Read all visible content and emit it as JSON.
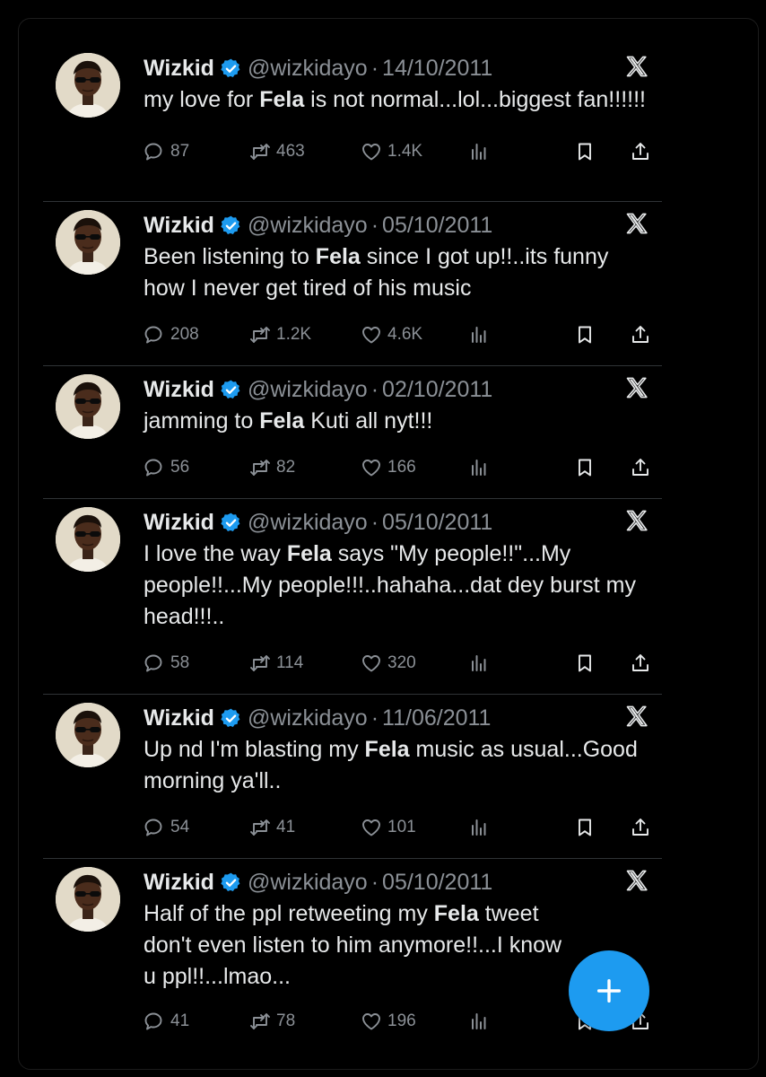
{
  "tweets": [
    {
      "name": "Wizkid",
      "handle": "@wizkidayo",
      "separator": "·",
      "date": "14/10/2011",
      "text_parts": [
        "my love for ",
        "Fela",
        " is not normal...lol...biggest fan!!!!!!"
      ],
      "replies": "87",
      "retweets": "463",
      "likes": "1.4K"
    },
    {
      "name": "Wizkid",
      "handle": "@wizkidayo",
      "separator": "·",
      "date": "05/10/2011",
      "text_parts": [
        "Been listening to ",
        "Fela",
        " since I got up!!..its funny how I never get tired of his music"
      ],
      "replies": "208",
      "retweets": "1.2K",
      "likes": "4.6K"
    },
    {
      "name": "Wizkid",
      "handle": "@wizkidayo",
      "separator": "·",
      "date": "02/10/2011",
      "text_parts": [
        "jamming to ",
        "Fela",
        " Kuti all nyt!!!"
      ],
      "replies": "56",
      "retweets": "82",
      "likes": "166"
    },
    {
      "name": "Wizkid",
      "handle": "@wizkidayo",
      "separator": "·",
      "date": "05/10/2011",
      "text_parts": [
        "I love the way ",
        "Fela",
        " says \"My people!!\"...My people!!...My people!!!..hahaha...dat dey burst my head!!!.."
      ],
      "replies": "58",
      "retweets": "114",
      "likes": "320"
    },
    {
      "name": "Wizkid",
      "handle": "@wizkidayo",
      "separator": "·",
      "date": "11/06/2011",
      "text_parts": [
        "Up nd I'm blasting my ",
        "Fela",
        " music as usual...Good morning ya'll.."
      ],
      "replies": "54",
      "retweets": "41",
      "likes": "101"
    },
    {
      "name": "Wizkid",
      "handle": "@wizkidayo",
      "separator": "·",
      "date": "05/10/2011",
      "text_parts": [
        "Half of the ppl retweeting my ",
        "Fela",
        " tweet don't even listen to him anymore!!...I know u ppl!!...lmao..."
      ],
      "replies": "41",
      "retweets": "78",
      "likes": "196"
    }
  ],
  "icons": {
    "verified": "verified-badge-icon",
    "platform": "x-logo-icon",
    "reply": "reply-icon",
    "retweet": "retweet-icon",
    "like": "heart-icon",
    "views": "views-icon",
    "bookmark": "bookmark-icon",
    "share": "share-icon",
    "compose": "plus-icon"
  },
  "colors": {
    "background": "#000000",
    "text": "#e7e9ea",
    "muted": "#8b9096",
    "accent": "#1d9bf0",
    "divider": "#2f3336"
  }
}
